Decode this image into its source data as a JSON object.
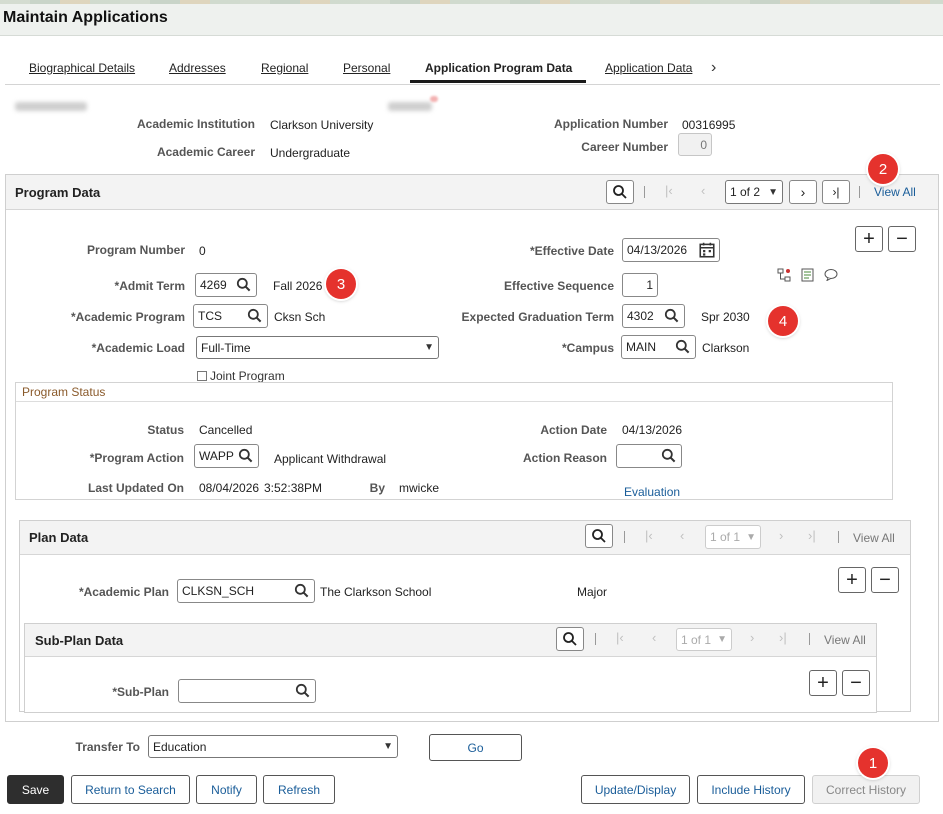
{
  "page": {
    "title": "Maintain Applications"
  },
  "tabs": [
    {
      "label": "Biographical Details"
    },
    {
      "label": "Addresses"
    },
    {
      "label": "Regional"
    },
    {
      "label": "Personal"
    },
    {
      "label": "Application Program Data"
    },
    {
      "label": "Application Data"
    }
  ],
  "header": {
    "institution_label": "Academic Institution",
    "institution": "Clarkson University",
    "career_label": "Academic Career",
    "career": "Undergraduate",
    "app_number_label": "Application Number",
    "app_number": "00316995",
    "career_number_label": "Career Number",
    "career_number": "0"
  },
  "program": {
    "title": "Program Data",
    "pager": "1 of 2",
    "view_all": "View All",
    "program_number_label": "Program Number",
    "program_number": "0",
    "admit_term_label": "*Admit Term",
    "admit_term": "4269",
    "admit_term_desc": "Fall 2026",
    "acad_program_label": "*Academic Program",
    "acad_program": "TCS",
    "acad_program_desc": "Cksn Sch",
    "acad_load_label": "*Academic Load",
    "acad_load": "Full-Time",
    "joint_program_label": "Joint Program",
    "eff_date_label": "*Effective Date",
    "eff_date": "04/13/2026",
    "eff_seq_label": "Effective Sequence",
    "eff_seq": "1",
    "exp_grad_label": "Expected Graduation Term",
    "exp_grad": "4302",
    "exp_grad_desc": "Spr 2030",
    "campus_label": "*Campus",
    "campus": "MAIN",
    "campus_desc": "Clarkson"
  },
  "status": {
    "title": "Program Status",
    "status_label": "Status",
    "status": "Cancelled",
    "action_label": "*Program Action",
    "action": "WAPP",
    "action_desc": "Applicant Withdrawal",
    "updated_label": "Last Updated On",
    "updated_date": "08/04/2026",
    "updated_time": "3:52:38PM",
    "by_label": "By",
    "by": "mwicke",
    "action_date_label": "Action Date",
    "action_date": "04/13/2026",
    "reason_label": "Action Reason",
    "reason": "",
    "evaluation_link": "Evaluation"
  },
  "plan": {
    "title": "Plan Data",
    "pager": "1 of 1",
    "view_all": "View All",
    "plan_label": "*Academic Plan",
    "plan": "CLKSN_SCH",
    "plan_desc": "The Clarkson School",
    "plan_type": "Major"
  },
  "subplan": {
    "title": "Sub-Plan Data",
    "pager": "1 of 1",
    "view_all": "View All",
    "subplan_label": "*Sub-Plan",
    "subplan": ""
  },
  "transfer": {
    "label": "Transfer To",
    "value": "Education",
    "go": "Go"
  },
  "buttons": {
    "save": "Save",
    "return": "Return to Search",
    "notify": "Notify",
    "refresh": "Refresh",
    "update": "Update/Display",
    "include": "Include History",
    "correct": "Correct History"
  },
  "markers": [
    "1",
    "2",
    "3",
    "4"
  ],
  "colors": {
    "link": "#1a5d99",
    "marker": "#e5322d",
    "primary_button": "#2e2e2e"
  }
}
